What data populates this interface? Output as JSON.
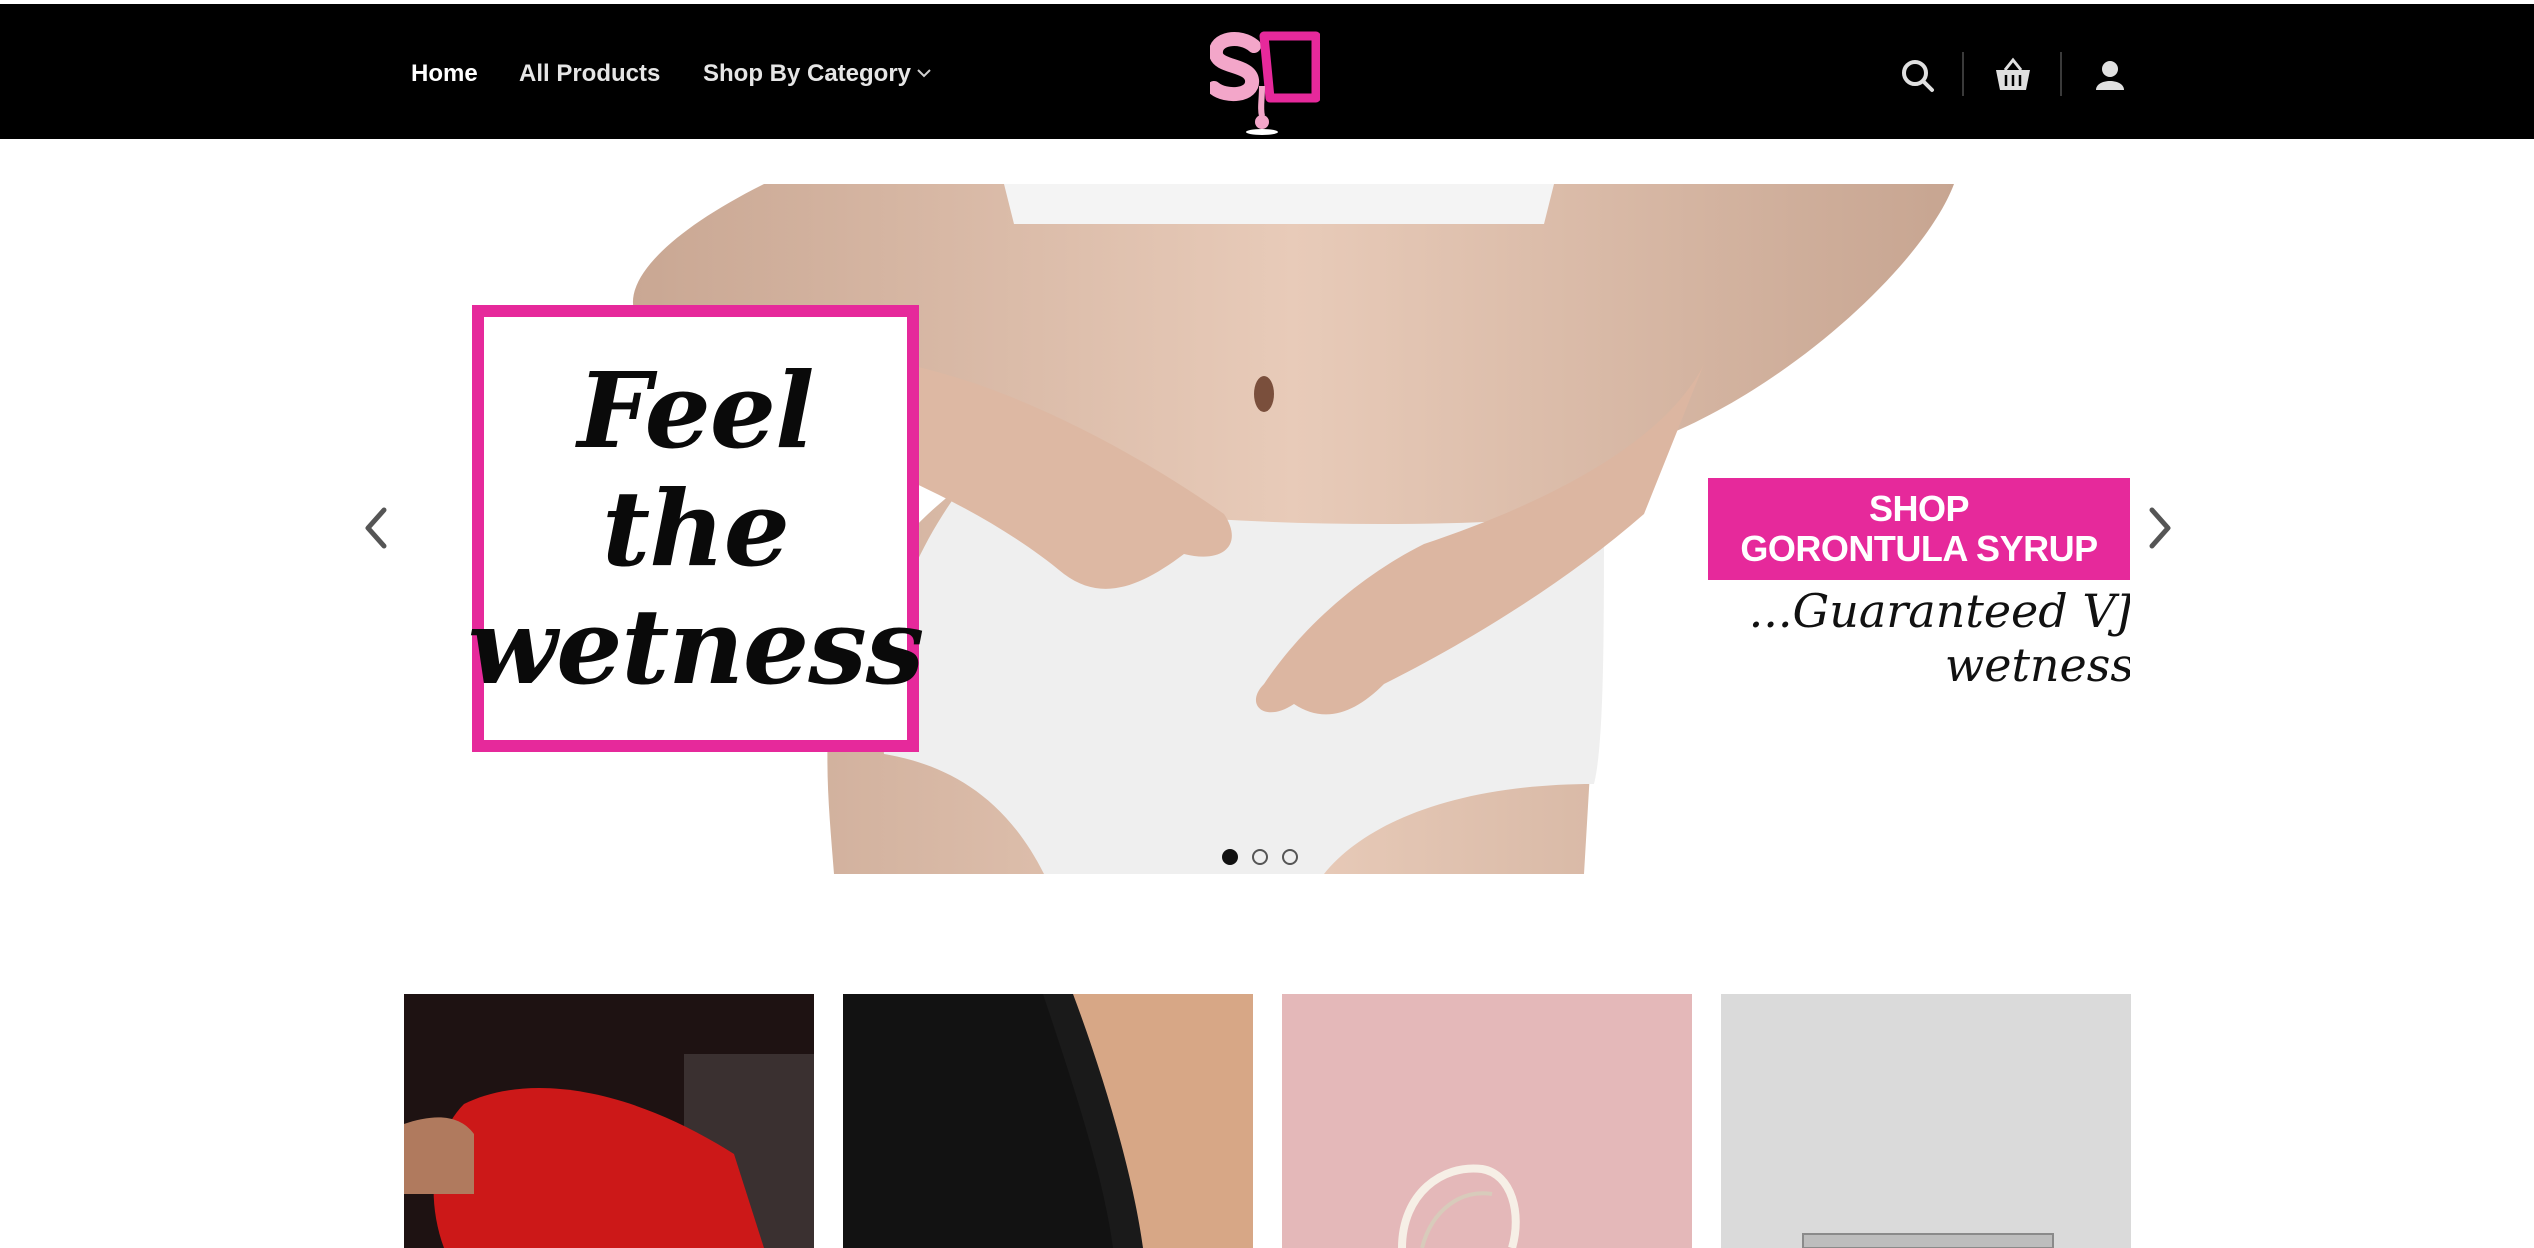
{
  "header": {
    "nav": [
      {
        "label": "Home"
      },
      {
        "label": "All Products"
      },
      {
        "label": "Shop By Category"
      }
    ],
    "icons": [
      "search-icon",
      "cart-icon",
      "account-icon"
    ]
  },
  "hero": {
    "slide": {
      "feel_line1": "Feel",
      "feel_line2": "the",
      "feel_line3": "wetness",
      "button_line1": "SHOP",
      "button_line2": "GORONTULA SYRUP",
      "tagline": "...Guaranteed VJ wetness"
    },
    "dots_count": 3,
    "active_dot": 1
  },
  "colors": {
    "header_bg": "#000000",
    "accent_pink": "#e6299b",
    "text_dark": "#0a0a0a"
  }
}
